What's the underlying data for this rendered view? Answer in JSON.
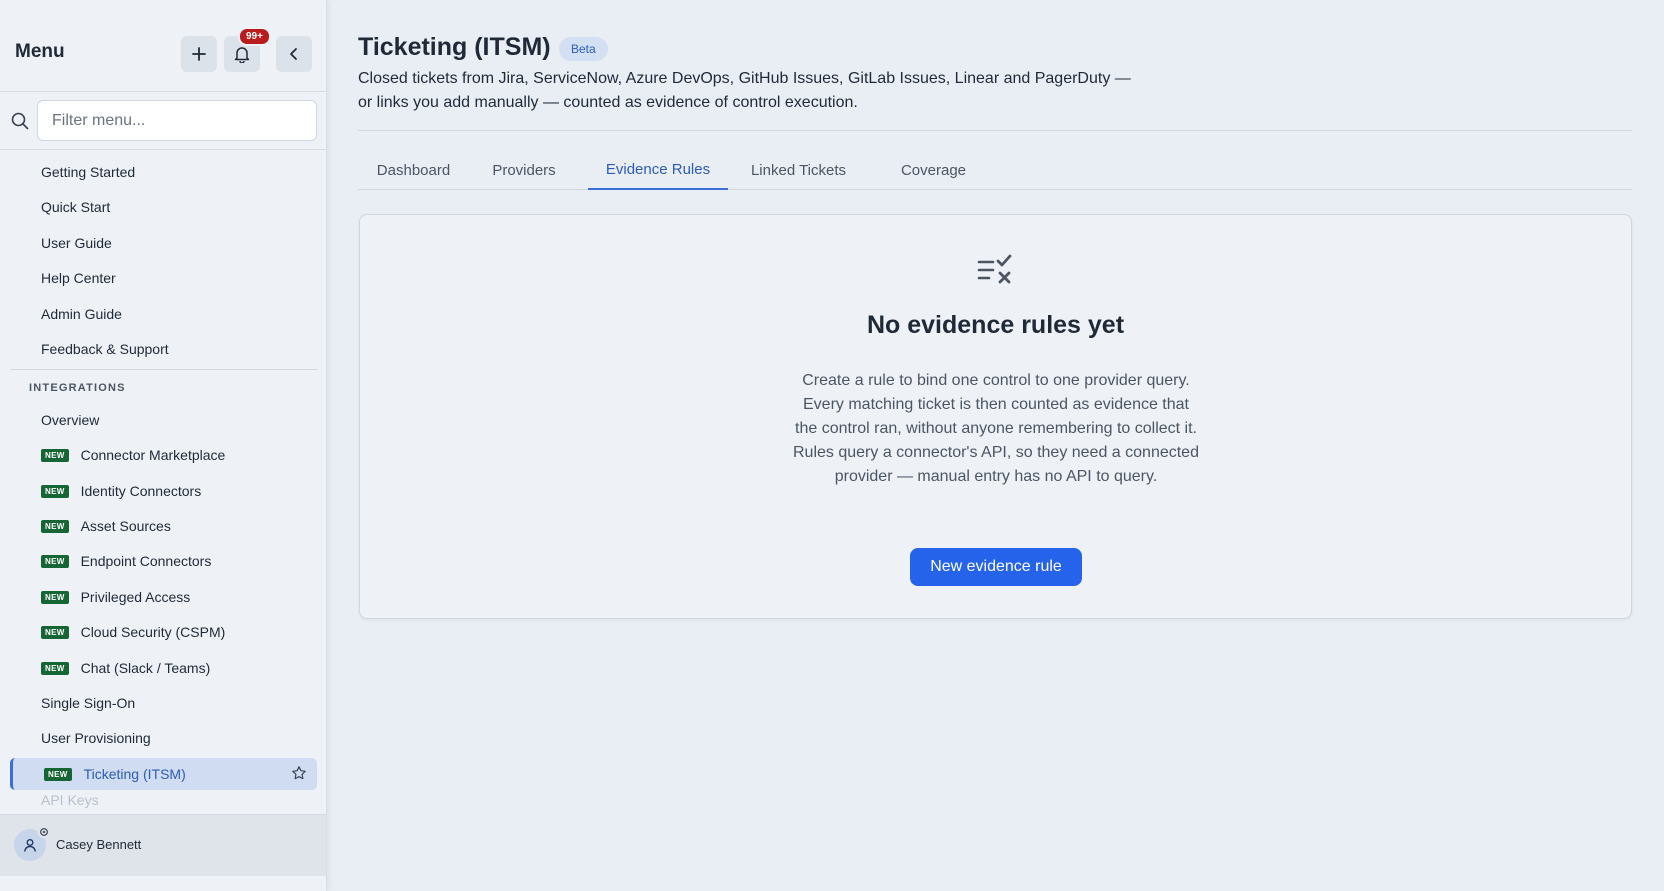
{
  "sidebar": {
    "title": "Menu",
    "notification_count": "99+",
    "search_placeholder": "Filter menu...",
    "help_items": [
      {
        "label": "Getting Started"
      },
      {
        "label": "Quick Start"
      },
      {
        "label": "User Guide"
      },
      {
        "label": "Help Center"
      },
      {
        "label": "Admin Guide"
      },
      {
        "label": "Feedback & Support"
      }
    ],
    "section_label": "INTEGRATIONS",
    "integration_items": [
      {
        "label": "Overview",
        "new": false
      },
      {
        "label": "Connector Marketplace",
        "new": true
      },
      {
        "label": "Identity Connectors",
        "new": true
      },
      {
        "label": "Asset Sources",
        "new": true
      },
      {
        "label": "Endpoint Connectors",
        "new": true
      },
      {
        "label": "Privileged Access",
        "new": true
      },
      {
        "label": "Cloud Security (CSPM)",
        "new": true
      },
      {
        "label": "Chat (Slack / Teams)",
        "new": true
      },
      {
        "label": "Single Sign-On",
        "new": false
      },
      {
        "label": "User Provisioning",
        "new": false
      },
      {
        "label": "Ticketing (ITSM)",
        "new": true,
        "active": true
      },
      {
        "label": "API Keys",
        "new": false
      }
    ],
    "new_tag": "NEW",
    "user_name": "Casey Bennett"
  },
  "page": {
    "title": "Ticketing (ITSM)",
    "badge": "Beta",
    "description": "Closed tickets from Jira, ServiceNow, Azure DevOps, GitHub Issues, GitLab Issues, Linear and PagerDuty — or links you add manually — counted as evidence of control execution.",
    "tabs": [
      {
        "label": "Dashboard"
      },
      {
        "label": "Providers"
      },
      {
        "label": "Evidence Rules",
        "active": true
      },
      {
        "label": "Linked Tickets"
      },
      {
        "label": "Coverage"
      }
    ]
  },
  "empty_state": {
    "title": "No evidence rules yet",
    "description": "Create a rule to bind one control to one provider query. Every matching ticket is then counted as evidence that the control ran, without anyone remembering to collect it. Rules query a connector's API, so they need a connected provider — manual entry has no API to query.",
    "button_label": "New evidence rule"
  },
  "colors": {
    "accent": "#2563eb",
    "active_nav_bg": "#cfdcf1",
    "new_tag_bg": "#166534",
    "notification_badge": "#b91c1c"
  }
}
